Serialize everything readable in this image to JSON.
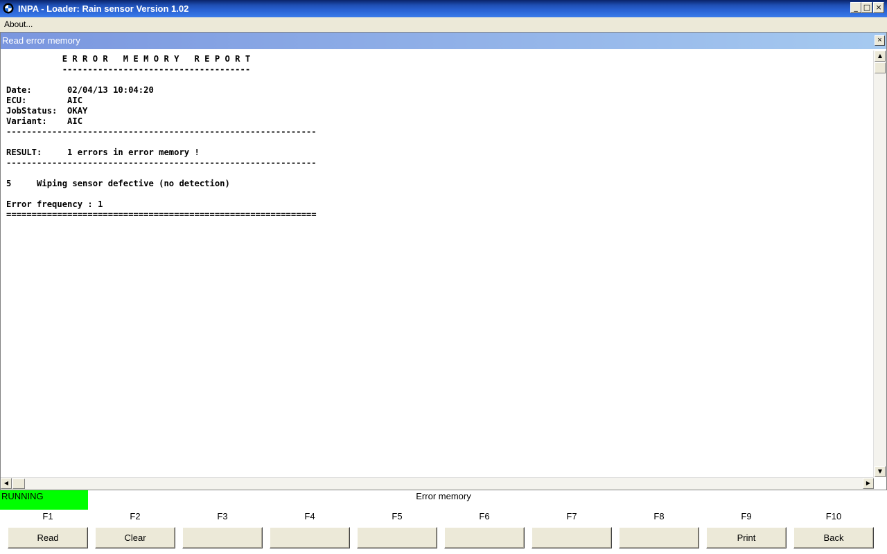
{
  "window": {
    "title": "INPA - Loader:  Rain sensor Version 1.02",
    "minimize": "_",
    "maximize": "□",
    "close": "×"
  },
  "menu": {
    "about": "About..."
  },
  "child": {
    "title": "Read error memory",
    "close": "×"
  },
  "report": {
    "lines": [
      "           E R R O R   M E M O R Y   R E P O R T",
      "           -------------------------------------",
      "",
      "Date:       02/04/13 10:04:20",
      "ECU:        AIC",
      "JobStatus:  OKAY",
      "Variant:    AIC",
      "-------------------------------------------------------------",
      "",
      "RESULT:     1 errors in error memory !",
      "-------------------------------------------------------------",
      "",
      "5     Wiping sensor defective (no detection)",
      "",
      "Error frequency : 1",
      "============================================================="
    ]
  },
  "status": {
    "state": "RUNNING",
    "state_color": "#00ff00",
    "text": "Error memory"
  },
  "fkeys": [
    {
      "key": "F1",
      "label": "Read"
    },
    {
      "key": "F2",
      "label": "Clear"
    },
    {
      "key": "F3",
      "label": ""
    },
    {
      "key": "F4",
      "label": ""
    },
    {
      "key": "F5",
      "label": ""
    },
    {
      "key": "F6",
      "label": ""
    },
    {
      "key": "F7",
      "label": ""
    },
    {
      "key": "F8",
      "label": ""
    },
    {
      "key": "F9",
      "label": "Print"
    },
    {
      "key": "F10",
      "label": "Back"
    }
  ]
}
